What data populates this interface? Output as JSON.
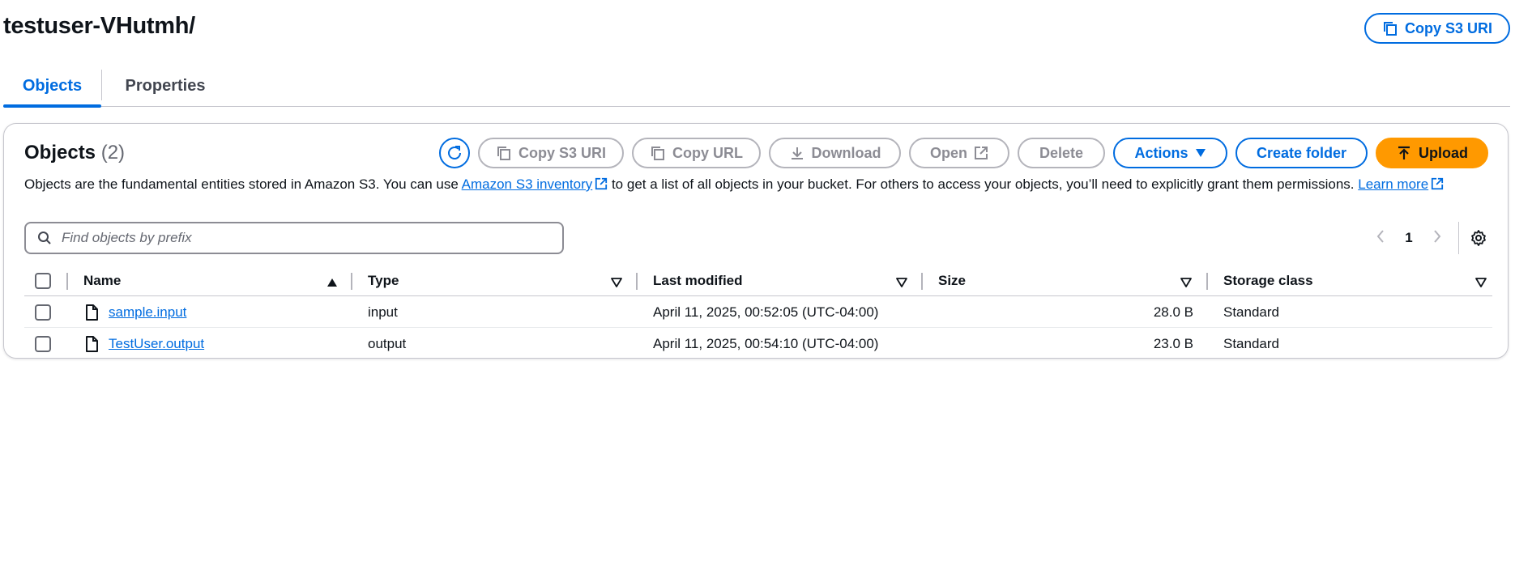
{
  "header": {
    "title": "testuser-VHutmh/",
    "copy_s3_uri_label": "Copy S3 URI"
  },
  "tabs": [
    {
      "label": "Objects",
      "selected": true
    },
    {
      "label": "Properties",
      "selected": false
    }
  ],
  "objects_panel": {
    "title": "Objects",
    "count": "(2)",
    "toolbar": {
      "refresh_icon": "refresh-icon",
      "copy_s3_uri_label": "Copy S3 URI",
      "copy_url_label": "Copy URL",
      "download_label": "Download",
      "open_label": "Open",
      "delete_label": "Delete",
      "actions_label": "Actions",
      "create_folder_label": "Create folder",
      "upload_label": "Upload"
    },
    "description": {
      "text_before": "Objects are the fundamental entities stored in Amazon S3. You can use ",
      "inventory_link": "Amazon S3 inventory",
      "text_after": " to get a list of all objects in your bucket. For others to access your objects, you’ll need to explicitly grant them permissions. ",
      "learn_more_link": "Learn more"
    },
    "search": {
      "placeholder": "Find objects by prefix",
      "value": ""
    },
    "pagination": {
      "current_page": "1"
    },
    "columns": [
      "Name",
      "Type",
      "Last modified",
      "Size",
      "Storage class"
    ],
    "rows": [
      {
        "name": "sample.input",
        "type": "input",
        "last_modified": "April 11, 2025, 00:52:05 (UTC-04:00)",
        "size": "28.0 B",
        "storage_class": "Standard"
      },
      {
        "name": "TestUser.output",
        "type": "output",
        "last_modified": "April 11, 2025, 00:54:10 (UTC-04:00)",
        "size": "23.0 B",
        "storage_class": "Standard"
      }
    ]
  },
  "colors": {
    "accent": "#006ce0",
    "upload": "#ff9900",
    "disabled": "#8c8c94",
    "border": "#c6c6cd"
  }
}
